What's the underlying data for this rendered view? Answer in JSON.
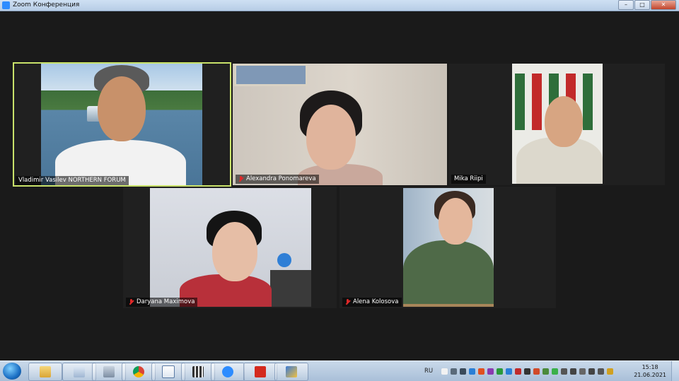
{
  "window": {
    "title": "Zoom Конференция",
    "controls": {
      "minimize": "–",
      "maximize": "□",
      "close": "✕"
    }
  },
  "participants": [
    {
      "name": "Vladimir Vasilev NORTHERN FORUM",
      "muted": false,
      "active_speaker": true
    },
    {
      "name": "Alexandra Ponomareva",
      "muted": true,
      "active_speaker": false
    },
    {
      "name": "Mika Riipi",
      "muted": false,
      "active_speaker": false
    },
    {
      "name": "Daryana Maximova",
      "muted": true,
      "active_speaker": false
    },
    {
      "name": "Alena Kolosova",
      "muted": true,
      "active_speaker": false
    }
  ],
  "taskbar": {
    "apps": [
      {
        "icon": "file-explorer-icon"
      },
      {
        "icon": "generic-window-icon"
      },
      {
        "icon": "calculator-icon"
      },
      {
        "icon": "chrome-icon"
      },
      {
        "icon": "document-icon"
      },
      {
        "icon": "video-editor-icon"
      },
      {
        "icon": "zoom-icon"
      },
      {
        "icon": "pdf-reader-icon"
      },
      {
        "icon": "app-icon"
      }
    ],
    "language": "RU",
    "clock": {
      "time": "15:18",
      "date": "21.06.2021"
    }
  },
  "colors": {
    "active_speaker_border": "#c9e26a",
    "muted_icon": "#e02828",
    "zoom_blue": "#2d8cff"
  }
}
